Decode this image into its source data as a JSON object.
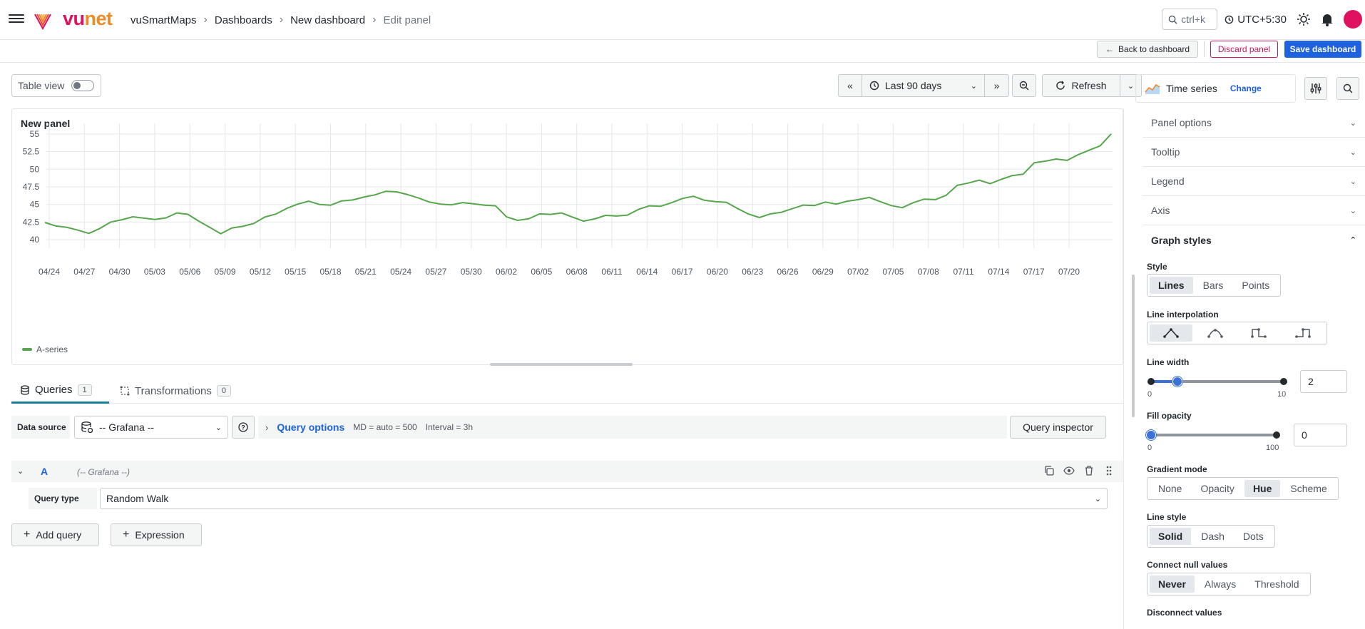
{
  "app": {
    "logo_vu": "vu",
    "logo_net": "net",
    "breadcrumbs": [
      "vuSmartMaps",
      "Dashboards",
      "New dashboard",
      "Edit panel"
    ],
    "search_shortcut": "ctrl+k",
    "timezone": "UTC+5:30"
  },
  "actions": {
    "back": "Back to dashboard",
    "discard": "Discard panel",
    "save": "Save dashboard"
  },
  "panel_toolbar": {
    "table_view": "Table view",
    "time_range": "Last 90 days",
    "refresh": "Refresh"
  },
  "panel": {
    "title": "New panel",
    "legend": "A-series"
  },
  "colors": {
    "series": "#56a64b",
    "accent": "#1f62e0",
    "danger": "#d1165f",
    "brand_vu": "#e0115f",
    "brand_net": "#f08a24"
  },
  "chart_data": {
    "type": "line",
    "title": "New panel",
    "xlabel": "",
    "ylabel": "",
    "ylim": [
      38.8,
      56.5
    ],
    "y_ticks": [
      "40",
      "42.5",
      "45",
      "47.5",
      "50",
      "52.5",
      "55"
    ],
    "x_ticks": [
      "04/24",
      "04/27",
      "04/30",
      "05/03",
      "05/06",
      "05/09",
      "05/12",
      "05/15",
      "05/18",
      "05/21",
      "05/24",
      "05/27",
      "05/30",
      "06/02",
      "06/05",
      "06/08",
      "06/11",
      "06/14",
      "06/17",
      "06/20",
      "06/23",
      "06/26",
      "06/29",
      "07/02",
      "07/05",
      "07/08",
      "07/11",
      "07/14",
      "07/17",
      "07/20"
    ],
    "grid": true,
    "legend_position": "bottom-left",
    "series": [
      {
        "name": "A-series",
        "x_start": "04/23",
        "x_end": "07/22",
        "values": [
          42.6,
          42.0,
          41.7,
          41.2,
          41.0,
          41.6,
          42.4,
          43.0,
          43.3,
          43.0,
          42.7,
          43.2,
          43.8,
          43.5,
          42.8,
          41.8,
          40.8,
          41.5,
          42.0,
          42.3,
          43.1,
          43.8,
          44.5,
          45.0,
          45.3,
          45.1,
          44.9,
          45.4,
          45.8,
          46.1,
          46.3,
          46.7,
          46.9,
          46.4,
          45.8,
          45.5,
          45.1,
          44.9,
          45.1,
          45.2,
          44.9,
          44.7,
          43.4,
          42.8,
          42.9,
          43.5,
          43.7,
          43.8,
          43.1,
          42.8,
          43.0,
          43.4,
          43.2,
          43.6,
          44.3,
          44.7,
          44.9,
          45.3,
          45.8,
          46.0,
          45.7,
          45.4,
          45.2,
          44.6,
          43.7,
          43.1,
          43.5,
          44.0,
          44.4,
          44.8,
          45.0,
          45.4,
          45.0,
          45.3,
          45.8,
          46.0,
          45.3,
          45.0,
          44.6,
          45.2,
          45.6,
          45.8,
          46.3,
          47.6,
          48.2,
          48.5,
          47.9,
          48.4,
          49.2,
          49.3,
          50.8,
          51.3,
          51.5,
          51.2,
          51.9,
          52.8,
          53.3,
          54.9
        ]
      }
    ]
  },
  "tabs": [
    {
      "label": "Queries",
      "count": "1"
    },
    {
      "label": "Transformations",
      "count": "0"
    }
  ],
  "query_bar": {
    "data_source_label": "Data source",
    "data_source_value": "-- Grafana --",
    "query_options_title": "Query options",
    "md": "MD = auto = 500",
    "interval": "Interval = 3h",
    "inspector": "Query inspector"
  },
  "query": {
    "letter": "A",
    "ds_name": "(-- Grafana --)",
    "type_label": "Query type",
    "type_value": "Random Walk"
  },
  "add_buttons": {
    "add_query": "Add query",
    "expression": "Expression"
  },
  "options": {
    "viz_name": "Time series",
    "viz_change": "Change",
    "sections": [
      "Panel options",
      "Tooltip",
      "Legend",
      "Axis",
      "Graph styles"
    ],
    "style": {
      "label": "Style",
      "options": [
        "Lines",
        "Bars",
        "Points"
      ],
      "selected": "Lines"
    },
    "line_interpolation": {
      "label": "Line interpolation"
    },
    "line_width": {
      "label": "Line width",
      "min": "0",
      "max": "10",
      "value": "2",
      "fraction": 0.2
    },
    "fill_opacity": {
      "label": "Fill opacity",
      "min": "0",
      "max": "100",
      "value": "0",
      "fraction": 0.0
    },
    "gradient_mode": {
      "label": "Gradient mode",
      "options": [
        "None",
        "Opacity",
        "Hue",
        "Scheme"
      ],
      "selected": "Hue"
    },
    "line_style": {
      "label": "Line style",
      "options": [
        "Solid",
        "Dash",
        "Dots"
      ],
      "selected": "Solid"
    },
    "connect_null": {
      "label": "Connect null values",
      "options": [
        "Never",
        "Always",
        "Threshold"
      ],
      "selected": "Never"
    },
    "disconnect": {
      "label": "Disconnect values"
    }
  }
}
